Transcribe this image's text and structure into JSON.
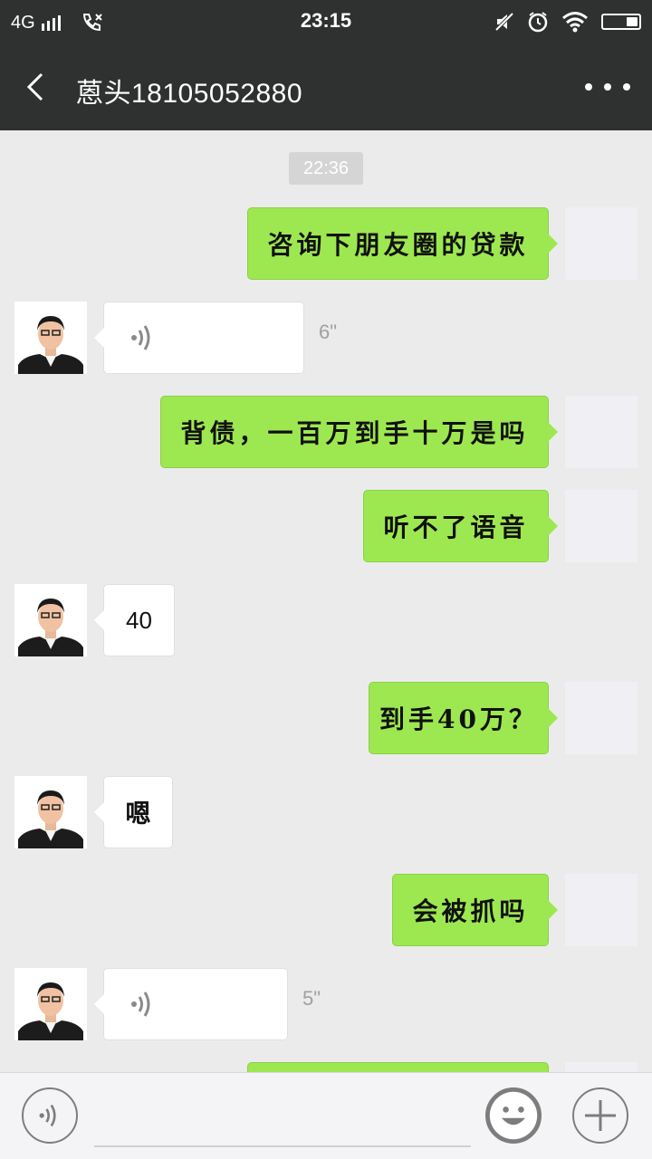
{
  "status_bar": {
    "network": "4G",
    "time": "23:15"
  },
  "header": {
    "title": "蒽头18105052880"
  },
  "chat": {
    "timestamp": "22:36",
    "messages": [
      {
        "side": "out",
        "type": "text",
        "text": "咨询下朋友圈的贷款"
      },
      {
        "side": "in",
        "type": "voice",
        "duration": "6\""
      },
      {
        "side": "out",
        "type": "text",
        "text": "背债，一百万到手十万是吗"
      },
      {
        "side": "out",
        "type": "text",
        "text": "听不了语音"
      },
      {
        "side": "in",
        "type": "text",
        "text": "40"
      },
      {
        "side": "out",
        "type": "text",
        "text": "到手40万？"
      },
      {
        "side": "in",
        "type": "text",
        "text": "嗯"
      },
      {
        "side": "out",
        "type": "text",
        "text": "会被抓吗"
      },
      {
        "side": "in",
        "type": "voice",
        "duration": "5\""
      }
    ]
  },
  "input_bar": {
    "voice_icon": "voice-mode-icon",
    "emoji_icon": "emoji-icon",
    "plus_icon": "plus-icon"
  }
}
